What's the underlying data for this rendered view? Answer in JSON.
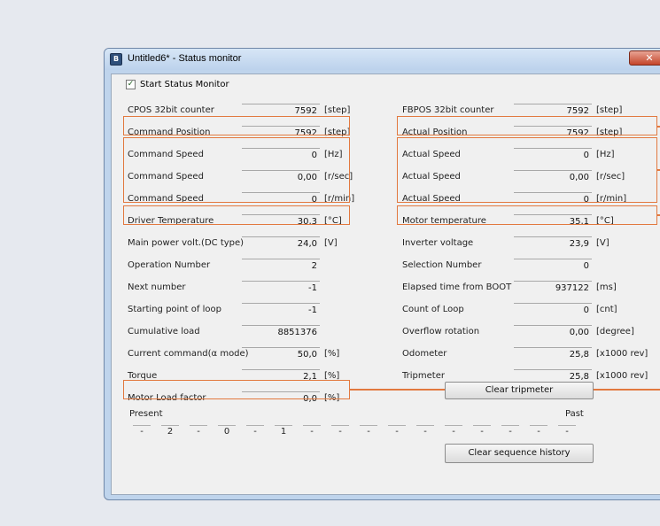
{
  "window": {
    "title": "Untitled6* - Status monitor",
    "icon_text": "B",
    "close_glyph": "✕"
  },
  "start_monitor": {
    "label": "Start Status Monitor",
    "checked": true,
    "check_glyph": "✓"
  },
  "left_rows": [
    {
      "label": "CPOS 32bit counter",
      "value": "7592",
      "unit": "[step]"
    },
    {
      "label": "Command Position",
      "value": "7592",
      "unit": "[step]"
    },
    {
      "label": "Command Speed",
      "value": "0",
      "unit": "[Hz]"
    },
    {
      "label": "Command Speed",
      "value": "0,00",
      "unit": "[r/sec]"
    },
    {
      "label": "Command Speed",
      "value": "0",
      "unit": "[r/min]"
    },
    {
      "label": "Driver Temperature",
      "value": "30,3",
      "unit": "[°C]"
    },
    {
      "label": "Main power volt.(DC type)",
      "value": "24,0",
      "unit": "[V]"
    },
    {
      "label": "Operation Number",
      "value": "2",
      "unit": ""
    },
    {
      "label": "Next number",
      "value": "-1",
      "unit": ""
    },
    {
      "label": "Starting point of loop",
      "value": "-1",
      "unit": ""
    },
    {
      "label": "Cumulative load",
      "value": "8851376",
      "unit": ""
    },
    {
      "label": "Current command(α mode)",
      "value": "50,0",
      "unit": "[%]"
    },
    {
      "label": "Torque",
      "value": "2,1",
      "unit": "[%]"
    },
    {
      "label": "Motor Load factor",
      "value": "0,0",
      "unit": "[%]"
    }
  ],
  "right_rows": [
    {
      "label": "FBPOS 32bit counter",
      "value": "7592",
      "unit": "[step]"
    },
    {
      "label": "Actual Position",
      "value": "7592",
      "unit": "[step]"
    },
    {
      "label": "Actual Speed",
      "value": "0",
      "unit": "[Hz]"
    },
    {
      "label": "Actual Speed",
      "value": "0,00",
      "unit": "[r/sec]"
    },
    {
      "label": "Actual Speed",
      "value": "0",
      "unit": "[r/min]"
    },
    {
      "label": "Motor temperature",
      "value": "35,1",
      "unit": "[°C]"
    },
    {
      "label": "Inverter voltage",
      "value": "23,9",
      "unit": "[V]"
    },
    {
      "label": "Selection Number",
      "value": "0",
      "unit": ""
    },
    {
      "label": "Elapsed time from BOOT",
      "value": "937122",
      "unit": "[ms]"
    },
    {
      "label": "Count of Loop",
      "value": "0",
      "unit": "[cnt]"
    },
    {
      "label": "Overflow rotation",
      "value": "0,00",
      "unit": "[degree]"
    },
    {
      "label": "Odometer",
      "value": "25,8",
      "unit": "[x1000 rev]"
    },
    {
      "label": "Tripmeter",
      "value": "25,8",
      "unit": "[x1000 rev]"
    }
  ],
  "buttons": {
    "clear_tripmeter": "Clear tripmeter",
    "clear_sequence_history": "Clear sequence history"
  },
  "sequence": {
    "present_label": "Present",
    "past_label": "Past",
    "cells": [
      "-",
      "2",
      "-",
      "0",
      "-",
      "1",
      "-",
      "-",
      "-",
      "-",
      "-",
      "-",
      "-",
      "-",
      "-",
      "-"
    ]
  },
  "highlight_color": "#e2793f"
}
